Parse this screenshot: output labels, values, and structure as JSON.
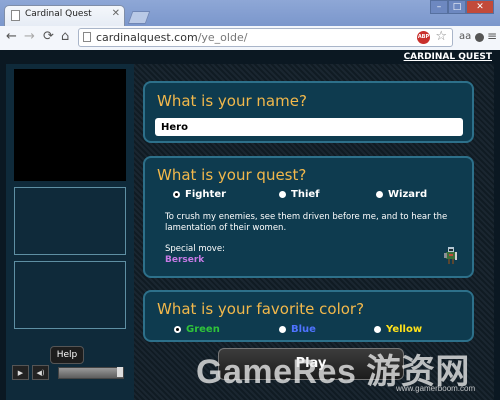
{
  "browser": {
    "tab_title": "Cardinal Quest",
    "url_host": "cardinalquest.com",
    "url_path": "/ye_olde/",
    "adblock_label": "ABP"
  },
  "site": {
    "title_link": "CARDINAL QUEST"
  },
  "name_section": {
    "question": "What is your name?",
    "value": "Hero"
  },
  "quest_section": {
    "question": "What is your quest?",
    "options": [
      "Fighter",
      "Thief",
      "Wizard"
    ],
    "selected": "Fighter",
    "description": "To crush my enemies, see them driven before me, and to hear the lamentation of their women.",
    "special_label": "Special move:",
    "special_value": "Berserk"
  },
  "color_section": {
    "question": "What is your favorite color?",
    "options": [
      {
        "label": "Green",
        "color": "#2fc43a"
      },
      {
        "label": "Blue",
        "color": "#4f73ff"
      },
      {
        "label": "Yellow",
        "color": "#ffe11a"
      }
    ],
    "selected": "Green"
  },
  "controls": {
    "help_label": "Help",
    "play_label": "Play"
  },
  "watermark": {
    "text": "GameRes 游资网",
    "url": "www.gamerboom.com"
  },
  "colors": {
    "accent_heading": "#f2b84b",
    "panel_bg": "#0e3b4f",
    "panel_border": "#2d708a",
    "special_move": "#c77ae6"
  }
}
